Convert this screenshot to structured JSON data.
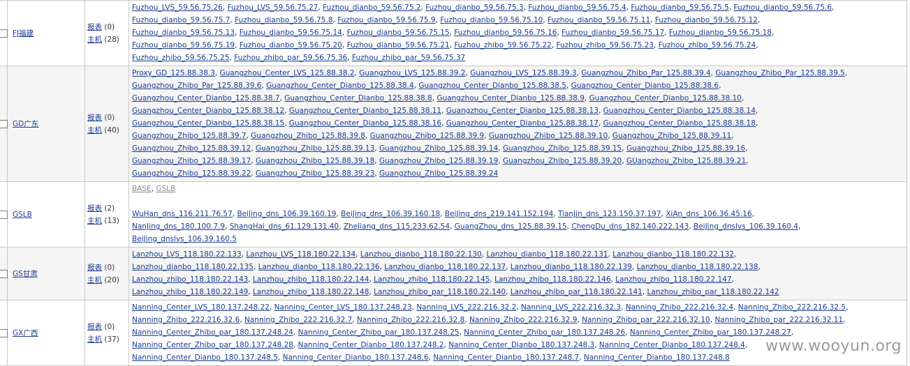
{
  "groups": [
    {
      "name": "FJ福建",
      "monitor_label": "报表",
      "monitor_count": "(0)",
      "host_label": "主机",
      "host_count": "(28)",
      "lines": [
        [
          "Fuzhou_LVS_59.56.75.26",
          "Fuzhou_LVS_59.56.75.27",
          "Fuzhou_dianbo_59.56.75.2",
          "Fuzhou_dianbo_59.56.75.3",
          "Fuzhou_dianbo_59.56.75.4",
          "Fuzhou_dianbo_59.56.75.5",
          "Fuzhou_dianbo_59.56.75.6"
        ],
        [
          "Fuzhou_dianbo_59.56.75.7",
          "Fuzhou_dianbo_59.56.75.8",
          "Fuzhou_dianbo_59.56.75.9",
          "Fuzhou_dianbo_59.56.75.10",
          "Fuzhou_dianbo_59.56.75.11",
          "Fuzhou_dianbo_59.56.75.12"
        ],
        [
          "Fuzhou_dianbo_59.56.75.13",
          "Fuzhou_dianbo_59.56.75.14",
          "Fuzhou_dianbo_59.56.75.15",
          "Fuzhou_dianbo_59.56.75.16",
          "Fuzhou_dianbo_59.56.75.17",
          "Fuzhou_dianbo_59.56.75.18"
        ],
        [
          "Fuzhou_dianbo_59.56.75.19",
          "Fuzhou_dianbo_59.56.75.20",
          "Fuzhou_dianbo_59.56.75.21",
          "Fuzhou_zhibo_59.56.75.22",
          "Fuzhou_zhibo_59.56.75.23",
          "Fuzhou_zhibo_59.56.75.24"
        ],
        [
          "Fuzhou_zhibo_59.56.75.25",
          "Fuzhou_zhibo_par_59.56.75.36",
          "Fuzhou_zhibo_par_59.56.75.37"
        ]
      ]
    },
    {
      "name": "GD广东",
      "monitor_label": "报表",
      "monitor_count": "(0)",
      "host_label": "主机",
      "host_count": "(40)",
      "lines": [
        [
          "Proxy_GD_125.88.38.3",
          "Guangzhou_Center_LVS_125.88.38.2",
          "Guangzhou_LVS_125.88.39.2",
          "Guangzhou_LVS_125.88.39.3",
          "Guangzhou_Zhibo_Par_125.88.39.4",
          "Guangzhou_Zhibo_Par_125.88.39.5"
        ],
        [
          "Guangzhou_Zhibo_Par_125.88.39.6",
          "Guangzhou_Center_Dianbo_125.88.38.4",
          "Guangzhou_Center_Dianbo_125.88.38.5",
          "Guangzhou_Center_Dianbo_125.88.38.6"
        ],
        [
          "Guangzhou_Center_Dianbo_125.88.38.7",
          "Guangzhou_Center_Dianbo_125.88.38.8",
          "Guangzhou_Center_Dianbo_125.88.38.9",
          "Guangzhou_Center_Dianbo_125.88.38.10"
        ],
        [
          "Guangzhou_Center_Dianbo_125.88.38.12",
          "Guangzhou_Center_Dianbo_125.88.38.11",
          "Guangzhou_Center_Dianbo_125.88.38.13",
          "Guangzhou_Center_Dianbo_125.88.38.14"
        ],
        [
          "Guangzhou_Center_Dianbo_125.88.38.15",
          "Guangzhou_Center_Dianbo_125.88.38.16",
          "Guangzhou_Center_Dianbo_125.88.38.17",
          "Guangzhou_Center_Dianbo_125.88.38.18"
        ],
        [
          "Guangzhou_Zhibo_125.88.39.7",
          "Guangzhou_Zhibo_125.88.39.8",
          "Guangzhou_Zhibo_125.88.39.9",
          "Guangzhou_Zhibo_125.88.39.10",
          "Guangzhou_Zhibo_125.88.39.11"
        ],
        [
          "Guangzhou_Zhibo_125.88.39.12",
          "Guangzhou_Zhibo_125.88.39.13",
          "Guangzhou_Zhibo_125.88.39.14",
          "Guangzhou_Zhibo_125.88.39.15",
          "Guangzhou_Zhibo_125.88.39.16"
        ],
        [
          "Guangzhou_Zhibo_125.88.39.17",
          "Guangzhou_Zhibo_125.88.39.18",
          "Guangzhou_Zhibo_125.88.39.19",
          "Guangzhou_Zhibo_125.88.39.20",
          "GUangzhou_Zhibo_125.88.39.21"
        ],
        [
          "Guangzhou_Zhibo_125.88.39.22",
          "Guangzhou_Zhibo_125.88.39.23",
          "Guangzhou_Zhibo_125.88.39.24"
        ]
      ]
    },
    {
      "name": "GSLB",
      "monitor_label": "报表",
      "monitor_count": "(2)",
      "host_label": "主机",
      "host_count": "(13)",
      "sub_links": [
        "BASE",
        "GSLB"
      ],
      "lines": [
        [
          "WuHan_dns_116.211.76.57",
          "BeiJing_dns_106.39.160.19",
          "BeiJing_dns_106.39.160.18",
          "BeiJing_dns_219.141.152.194",
          "TianJin_dns_123.150.37.197",
          "XiAn_dns_106.36.45.16"
        ],
        [
          "NanJing_dns_180.100.7.9",
          "ShangHai_dns_61.129.131.40",
          "ZheJiang_dns_115.233.62.54",
          "GuangZhou_dns_125.88.39.15",
          "ChengDu_dns_182.140.222.143",
          "BeiJing_dnslvs_106.39.160.4"
        ],
        [
          "BeiJing_dnslvs_106.39.160.5"
        ]
      ]
    },
    {
      "name": "GS甘肃",
      "monitor_label": "报表",
      "monitor_count": "(0)",
      "host_label": "主机",
      "host_count": "(20)",
      "lines": [
        [
          "Lanzhou_LVS_118.180.22.133",
          "Lanzhou_LVS_118.180.22.134",
          "Lanzhou_dianbo_118.180.22.130",
          "Lanzhou_dianbo_118.180.22.131",
          "Lanzhou_dianbo_118.180.22.132"
        ],
        [
          "Lanzhou_dianbo_118.180.22.135",
          "Lanzhou_dianbo_118.180.22.136",
          "Lanzhou_dianbo_118.180.22.137",
          "Lanzhou_dianbo_118.180.22.139",
          "Lanzhou_dianbo_118.180.22.138"
        ],
        [
          "Lanzhou_zhibo_118.180.22.143",
          "Lanzhou_zhibo_118.180.22.144",
          "Lanzhou_zhibo_118.180.22.145",
          "Lanzhou_zhibo_118.180.22.146",
          "Lanzhou_zhibo_118.180.22.147"
        ],
        [
          "Lanzhou_zhibo_118.180.22.149",
          "Lanzhou_zhibo_118.180.22.148",
          "Lanzhou_zhibo_par_118.180.22.140",
          "Lanzhou_zhibo_par_118.180.22.141",
          "Lanzhou_zhibo_par_118.180.22.142"
        ]
      ]
    },
    {
      "name": "GX广西",
      "monitor_label": "报表",
      "monitor_count": "(0)",
      "host_label": "主机",
      "host_count": "(37)",
      "lines": [
        [
          "Nanning_Center_LVS_180.137.248.22",
          "Nanning_Center_LVS_180.137.248.23",
          "Nanning_LVS_222.216.32.2",
          "Nanning_LVS_222.216.32.3",
          "Nanning_Zhibo_222.216.32.4",
          "Nanning_Zhibo_222.216.32.5"
        ],
        [
          "Nanning_Zhibo_222.216.32.6",
          "Nanning_Zhibo_222.216.32.7",
          "Nanning_Zhibo_222.216.32.8",
          "Nanning_Zhibo_222.216.32.9",
          "Nanning_Zhibo_par_222.216.32.10",
          "Nanning_Zhibo_par_222.216.32.11"
        ],
        [
          "Nanning_Center_Zhibo_par_180.137.248.24",
          "Nanning_Center_Zhibo_par_180.137.248.25",
          "Nanning_Center_Zhibo_par_180.137.248.26",
          "Nanning_Center_Zhibo_par_180.137.248.27"
        ],
        [
          "Nanning_Center_Zhibo_par_180.137.248.28",
          "Nanning_Center_Dianbo_180.137.248.2",
          "Nanning_Center_Dianbo_180.137.248.3",
          "Nanning_Center_Dianbo_180.137.248.4"
        ],
        [
          "Nanning_Center_Dianbo_180.137.248.5",
          "Nanning_Center_Dianbo_180.137.248.6",
          "Nanning_Center_Dianbo_180.137.248.7",
          "Nanning_Center_Dianbo_180.137.248.8"
        ]
      ]
    }
  ],
  "watermark": "www.wooyun.org"
}
